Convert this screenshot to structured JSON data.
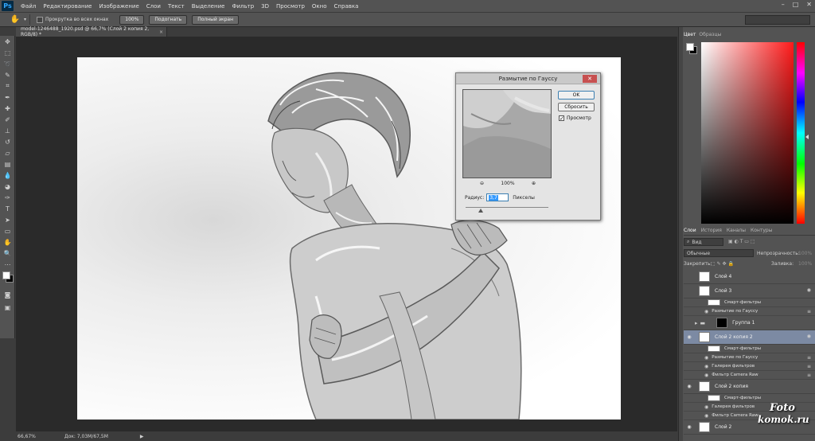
{
  "app": {
    "logo": "Ps"
  },
  "menu": [
    "Файл",
    "Редактирование",
    "Изображение",
    "Слои",
    "Текст",
    "Выделение",
    "Фильтр",
    "3D",
    "Просмотр",
    "Окно",
    "Справка"
  ],
  "options": {
    "tool_icon": "hand-icon",
    "scroll_all_label": "Прокрутка во всех окнах",
    "zoom100_label": "100%",
    "fit_label": "Подогнать",
    "fullscreen_label": "Полный экран"
  },
  "document": {
    "tab_title": "model-1246488_1920.psd @ 66,7% (Слой 2 копия 2, RGB/8) *",
    "tab_close": "×"
  },
  "status": {
    "zoom": "66,67%",
    "doc_size": "Док: 7,03M/67,5M",
    "arrow": "▶"
  },
  "dialog": {
    "title": "Размытие по Гауссу",
    "close": "✕",
    "ok_label": "OK",
    "reset_label": "Сбросить",
    "preview_label": "Просмотр",
    "preview_checked": true,
    "preview_zoom": "100%",
    "radius_label": "Радиус:",
    "radius_value": "3,7",
    "radius_unit": "Пикселы"
  },
  "color_panel": {
    "tabs": [
      "Цвет",
      "Образцы"
    ],
    "foreground": "#ffffff",
    "background": "#000000",
    "hue": "#ff0000"
  },
  "layers_panel": {
    "tabs": [
      "Слои",
      "История",
      "Каналы",
      "Контуры"
    ],
    "kind_label": "Вид",
    "blend_mode": "Обычные",
    "opacity_label": "Непрозрачность:",
    "opacity_value": "100%",
    "lock_label": "Закрепить:",
    "fill_label": "Заливка:",
    "fill_value": "100%",
    "layers": [
      {
        "name": "Слой 4",
        "visible": false
      },
      {
        "name": "Слой 3",
        "visible": false
      },
      {
        "name": "Группа 1",
        "visible": false
      },
      {
        "name": "Слой 2 копия 2",
        "visible": true,
        "selected": true
      },
      {
        "name": "Слой 2 копия",
        "visible": true
      },
      {
        "name": "Слой 2",
        "visible": true
      }
    ],
    "sublayers": {
      "layer3_smart": "Смарт-фильтры",
      "layer3_gauss": "Размытие по Гауссу",
      "copy2_smart": "Смарт-фильтры",
      "copy2_gauss": "Размытие по Гауссу",
      "copy2_gallery": "Галерея фильтров",
      "copy2_raw": "Фильтр Camera Raw",
      "copy_smart": "Смарт-фильтры",
      "copy_gallery": "Галерея фильтров",
      "copy_raw": "Фильтр Camera Raw"
    }
  },
  "watermark": {
    "line1": "Foto",
    "line2": "komok.ru"
  }
}
